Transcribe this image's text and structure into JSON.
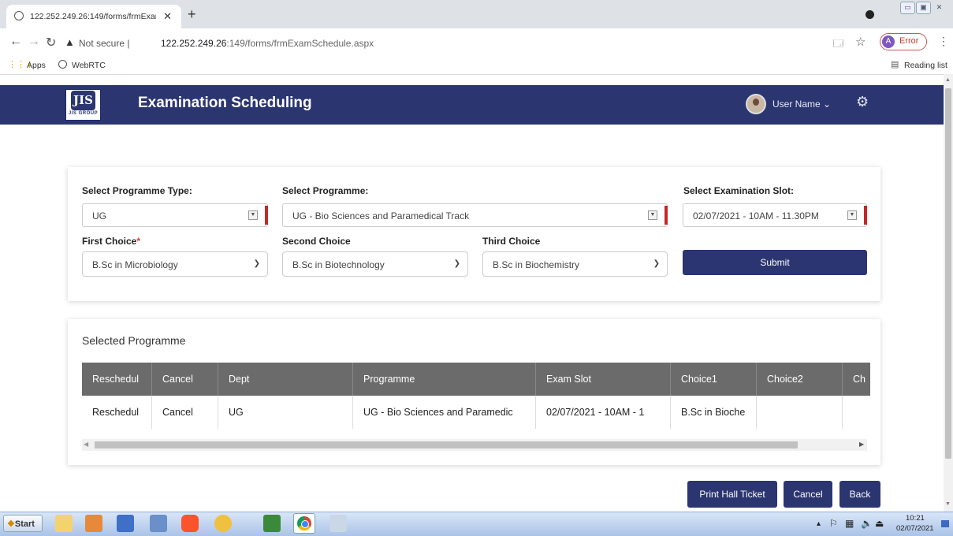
{
  "browser": {
    "tab_title": "122.252.249.26:149/forms/frmExam",
    "tab_close": "✕",
    "new_tab": "+",
    "security_label": "Not secure",
    "url_separator": "|",
    "url_host": "122.252.249.26",
    "url_rest": ":149/forms/frmExamSchedule.aspx",
    "profile_initial": "A",
    "profile_status": "Error",
    "bookmarks": [
      "Apps",
      "WebRTC"
    ],
    "reading_list": "Reading list"
  },
  "app": {
    "logo_mark": "JIS",
    "logo_text": "JIS GROUP",
    "title": "Examination Scheduling",
    "user_name": "User Name",
    "user_caret": "⌄"
  },
  "form": {
    "programme_type": {
      "label": "Select Programme Type:",
      "value": "UG"
    },
    "programme": {
      "label": "Select Programme:",
      "value": "UG - Bio Sciences and Paramedical Track"
    },
    "exam_slot": {
      "label": "Select Examination Slot:",
      "value": "02/07/2021 - 10AM - 11.30PM"
    },
    "first_choice": {
      "label": "First Choice",
      "required_mark": "*",
      "value": "B.Sc in Microbiology"
    },
    "second_choice": {
      "label": "Second Choice",
      "value": "B.Sc in Biotechnology"
    },
    "third_choice": {
      "label": "Third Choice",
      "value": "B.Sc in Biochemistry"
    },
    "submit_label": "Submit"
  },
  "selected": {
    "heading": "Selected Programme",
    "columns": [
      "Reschedul",
      "Cancel",
      "Dept",
      "Programme",
      "Exam Slot",
      "Choice1",
      "Choice2",
      "Ch"
    ],
    "rows": [
      [
        "Reschedul",
        "Cancel",
        "UG",
        "UG - Bio Sciences and Paramedic",
        "02/07/2021 - 10AM - 1",
        "B.Sc in Bioche",
        "",
        ""
      ]
    ]
  },
  "actions": {
    "print_label": "Print Hall Ticket",
    "cancel_label": "Cancel",
    "back_label": "Back"
  },
  "taskbar": {
    "start_label": "Start",
    "time": "10:21",
    "date": "02/07/2021"
  },
  "colors": {
    "brand": "#2b3570",
    "required_bar": "#c62828",
    "table_header": "#6b6b6b"
  }
}
